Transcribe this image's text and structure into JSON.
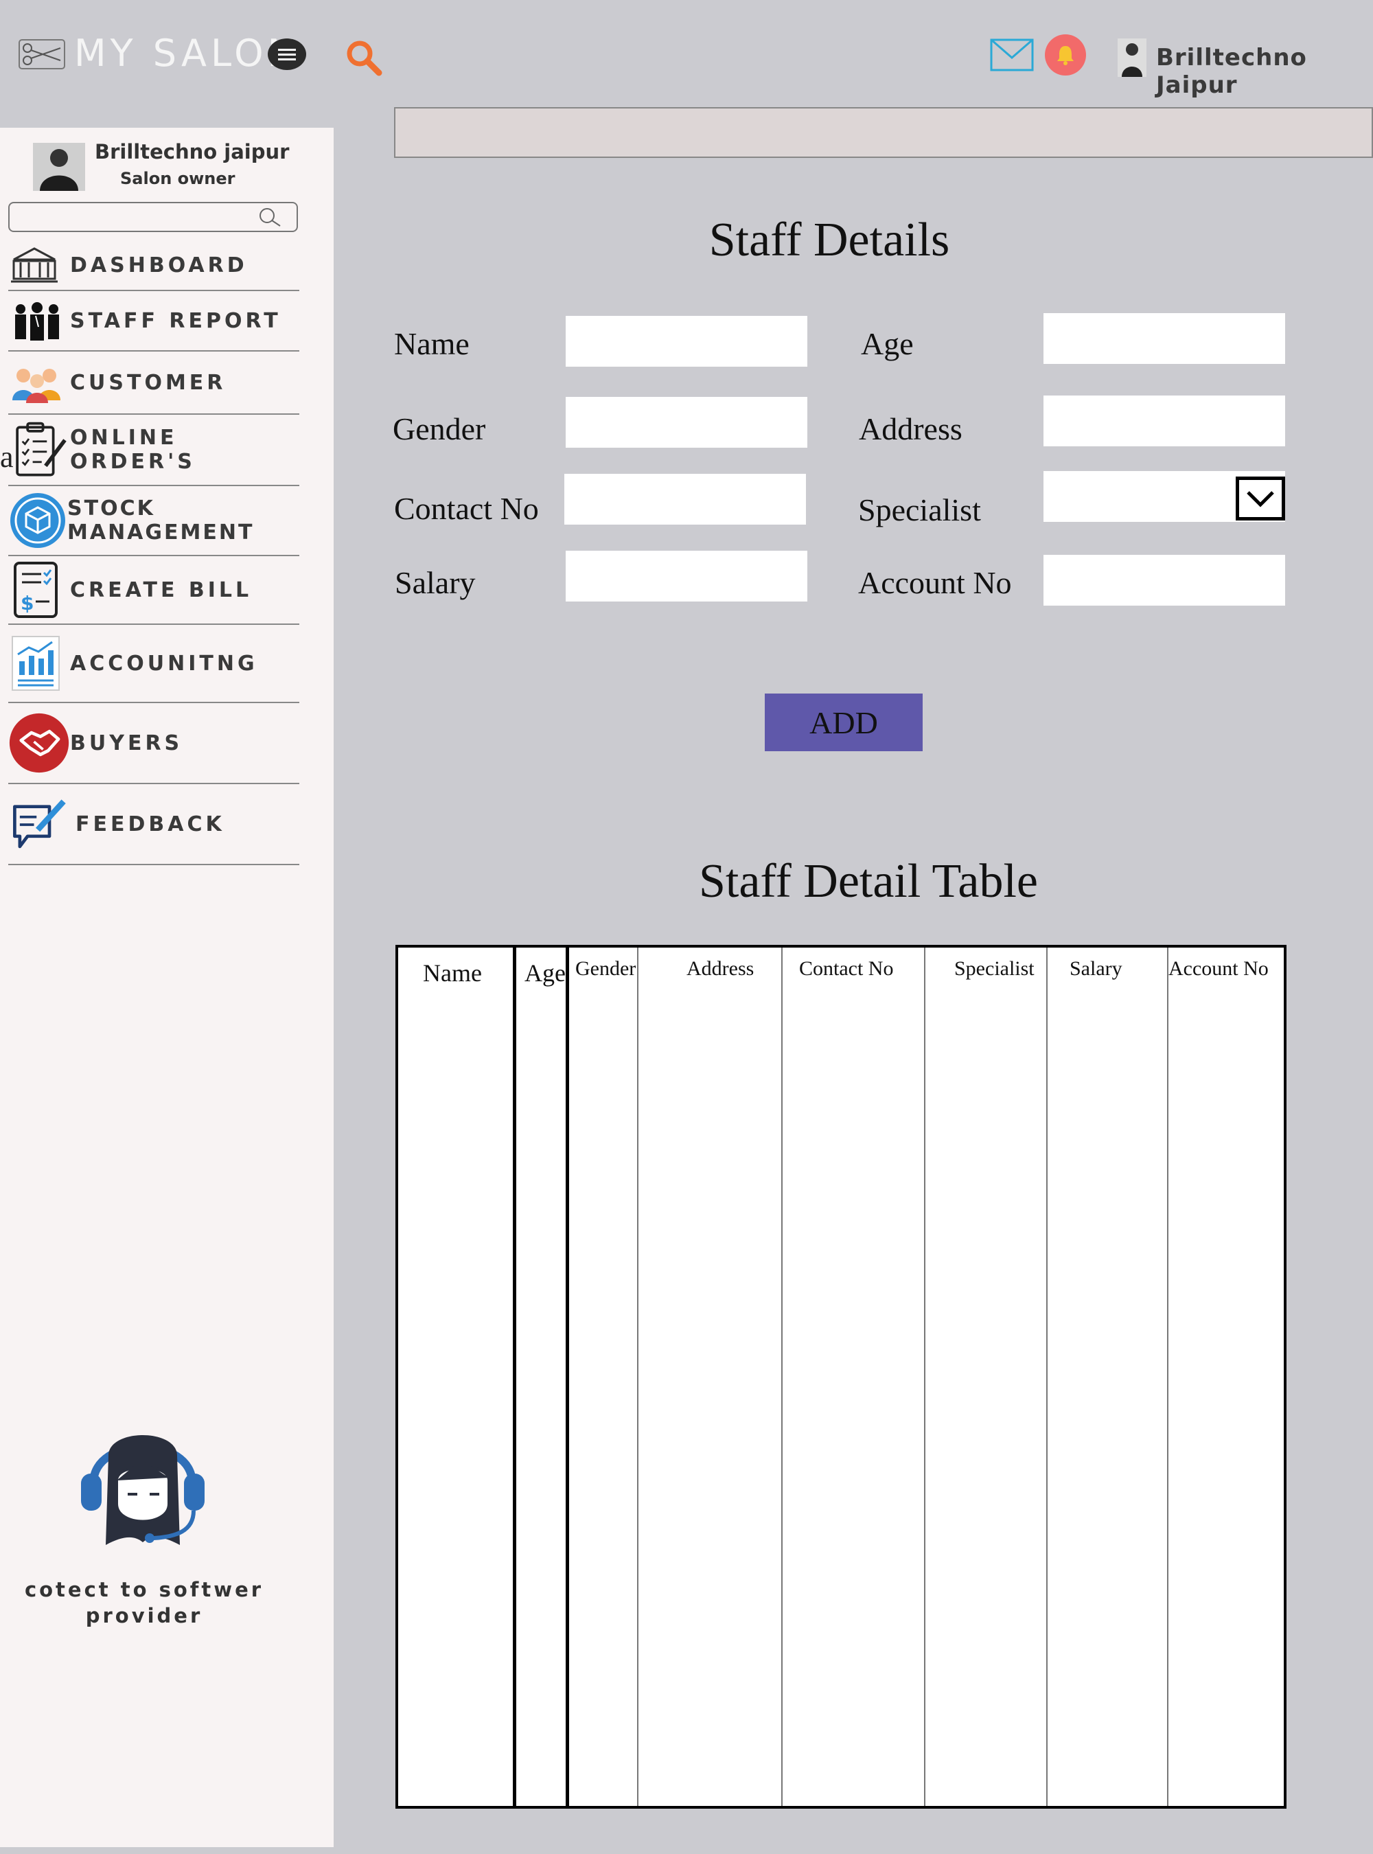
{
  "header": {
    "app_name": "MY SALON",
    "user_name": "Brilltechno Jaipur"
  },
  "sidebar": {
    "profile_name": "Brilltechno jaipur",
    "profile_role": "Salon owner",
    "search_placeholder": "",
    "stray_char": "a",
    "items": [
      {
        "label": "DASHBOARD",
        "icon": "dashboard-icon"
      },
      {
        "label": "STAFF REPORT",
        "icon": "staff-icon"
      },
      {
        "label": "CUSTOMER",
        "icon": "customer-icon"
      },
      {
        "label": "ONLINE ORDER'S",
        "icon": "clipboard-icon"
      },
      {
        "label": "STOCK MANAGEMENT",
        "icon": "stock-icon"
      },
      {
        "label": "CREATE BILL",
        "icon": "bill-icon"
      },
      {
        "label": "ACCOUNITNG",
        "icon": "chart-icon"
      },
      {
        "label": "BUYERS",
        "icon": "handshake-icon"
      },
      {
        "label": "FEEDBACK",
        "icon": "feedback-icon"
      }
    ],
    "support_text": "cotect to softwer provider"
  },
  "form": {
    "title": "Staff Details",
    "fields": {
      "name": "Name",
      "age": "Age",
      "gender": "Gender",
      "address": "Address",
      "contact": "Contact No",
      "specialist": "Specialist",
      "salary": "Salary",
      "account": "Account No"
    },
    "add_label": "ADD"
  },
  "table": {
    "title": "Staff Detail Table",
    "columns": [
      "Name",
      "Age",
      "Gender",
      "Address",
      "Contact No",
      "Specialist",
      "Salary",
      "Account No"
    ]
  },
  "colors": {
    "background": "#cbcbd0",
    "sidebar": "#f8f3f3",
    "accent_button": "#5f58aa",
    "search_orange": "#f07030",
    "bell_red": "#f26a6a",
    "mail_cyan": "#2aa9d6"
  }
}
